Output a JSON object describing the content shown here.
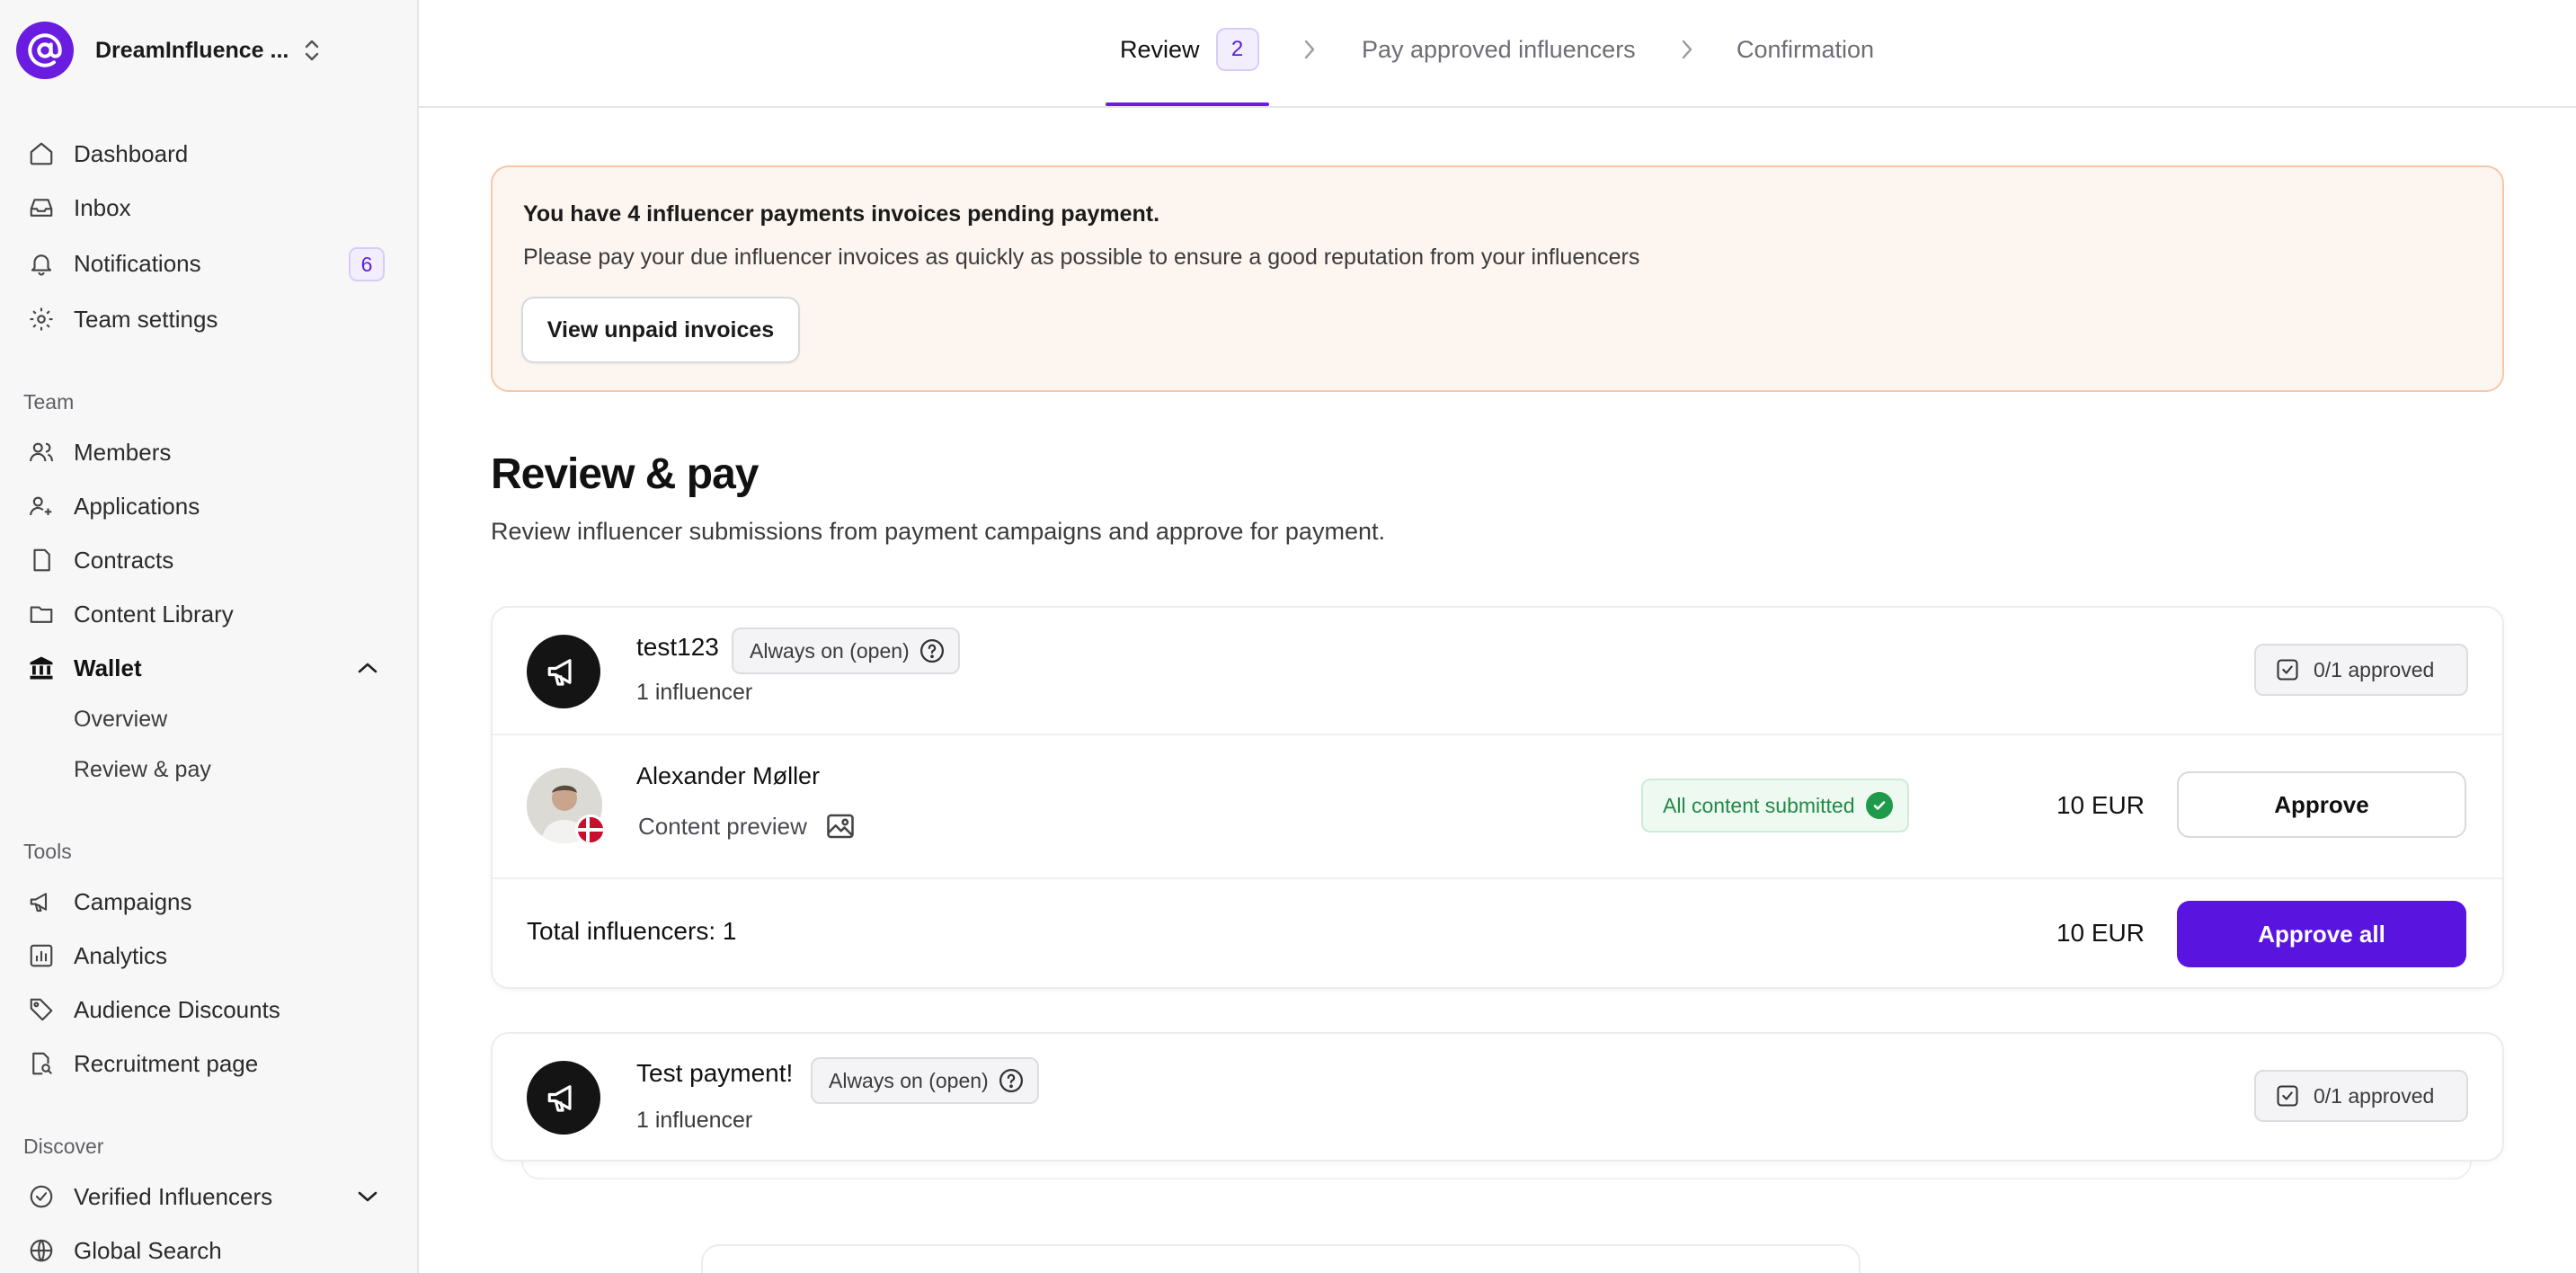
{
  "brand": {
    "name": "DreamInfluence ...",
    "logo_icon": "at-sign-icon",
    "accent": "#6a1de0"
  },
  "sidebar": {
    "main": [
      {
        "label": "Dashboard",
        "icon": "home-icon"
      },
      {
        "label": "Inbox",
        "icon": "inbox-icon"
      },
      {
        "label": "Notifications",
        "icon": "bell-icon",
        "badge": "6"
      },
      {
        "label": "Team settings",
        "icon": "gear-icon"
      }
    ],
    "team_label": "Team",
    "team": [
      {
        "label": "Members",
        "icon": "users-icon"
      },
      {
        "label": "Applications",
        "icon": "user-plus-icon"
      },
      {
        "label": "Contracts",
        "icon": "document-icon"
      },
      {
        "label": "Content Library",
        "icon": "folder-icon"
      },
      {
        "label": "Wallet",
        "icon": "bank-icon",
        "expanded": true
      }
    ],
    "wallet_sub": [
      {
        "label": "Overview"
      },
      {
        "label": "Review & pay"
      }
    ],
    "tools_label": "Tools",
    "tools": [
      {
        "label": "Campaigns",
        "icon": "megaphone-icon"
      },
      {
        "label": "Analytics",
        "icon": "bar-chart-icon"
      },
      {
        "label": "Audience Discounts",
        "icon": "tag-icon"
      },
      {
        "label": "Recruitment page",
        "icon": "search-document-icon"
      }
    ],
    "discover_label": "Discover",
    "discover": [
      {
        "label": "Verified Influencers",
        "icon": "verified-icon",
        "expandable": true
      },
      {
        "label": "Global Search",
        "icon": "globe-icon"
      }
    ]
  },
  "stepper": {
    "steps": [
      {
        "label": "Review",
        "count": "2",
        "active": true
      },
      {
        "label": "Pay approved influencers"
      },
      {
        "label": "Confirmation"
      }
    ]
  },
  "alert": {
    "title": "You have 4 influencer payments invoices pending payment.",
    "text": "Please pay your due influencer invoices as quickly as possible to ensure a good reputation from your influencers",
    "button": "View unpaid invoices"
  },
  "page": {
    "title": "Review & pay",
    "subtitle": "Review influencer submissions from payment campaigns and approve for payment."
  },
  "campaigns": [
    {
      "name": "test123",
      "tag": "Always on (open)",
      "count": "1 influencer",
      "approved": "0/1 approved",
      "influencer": {
        "name": "Alexander Møller",
        "preview": "Content preview",
        "status": "All content submitted",
        "amount": "10 EUR",
        "action": "Approve"
      },
      "total_label": "Total influencers: 1",
      "total_amount": "10 EUR",
      "approve_all": "Approve all"
    },
    {
      "name": "Test payment!",
      "tag": "Always on (open)",
      "count": "1 influencer",
      "approved": "0/1 approved"
    }
  ],
  "colors": {
    "primary": "#5a14e0",
    "success": "#1f9a4a",
    "alert_bg": "#fdf5ef",
    "alert_border": "#f6c8a8"
  }
}
